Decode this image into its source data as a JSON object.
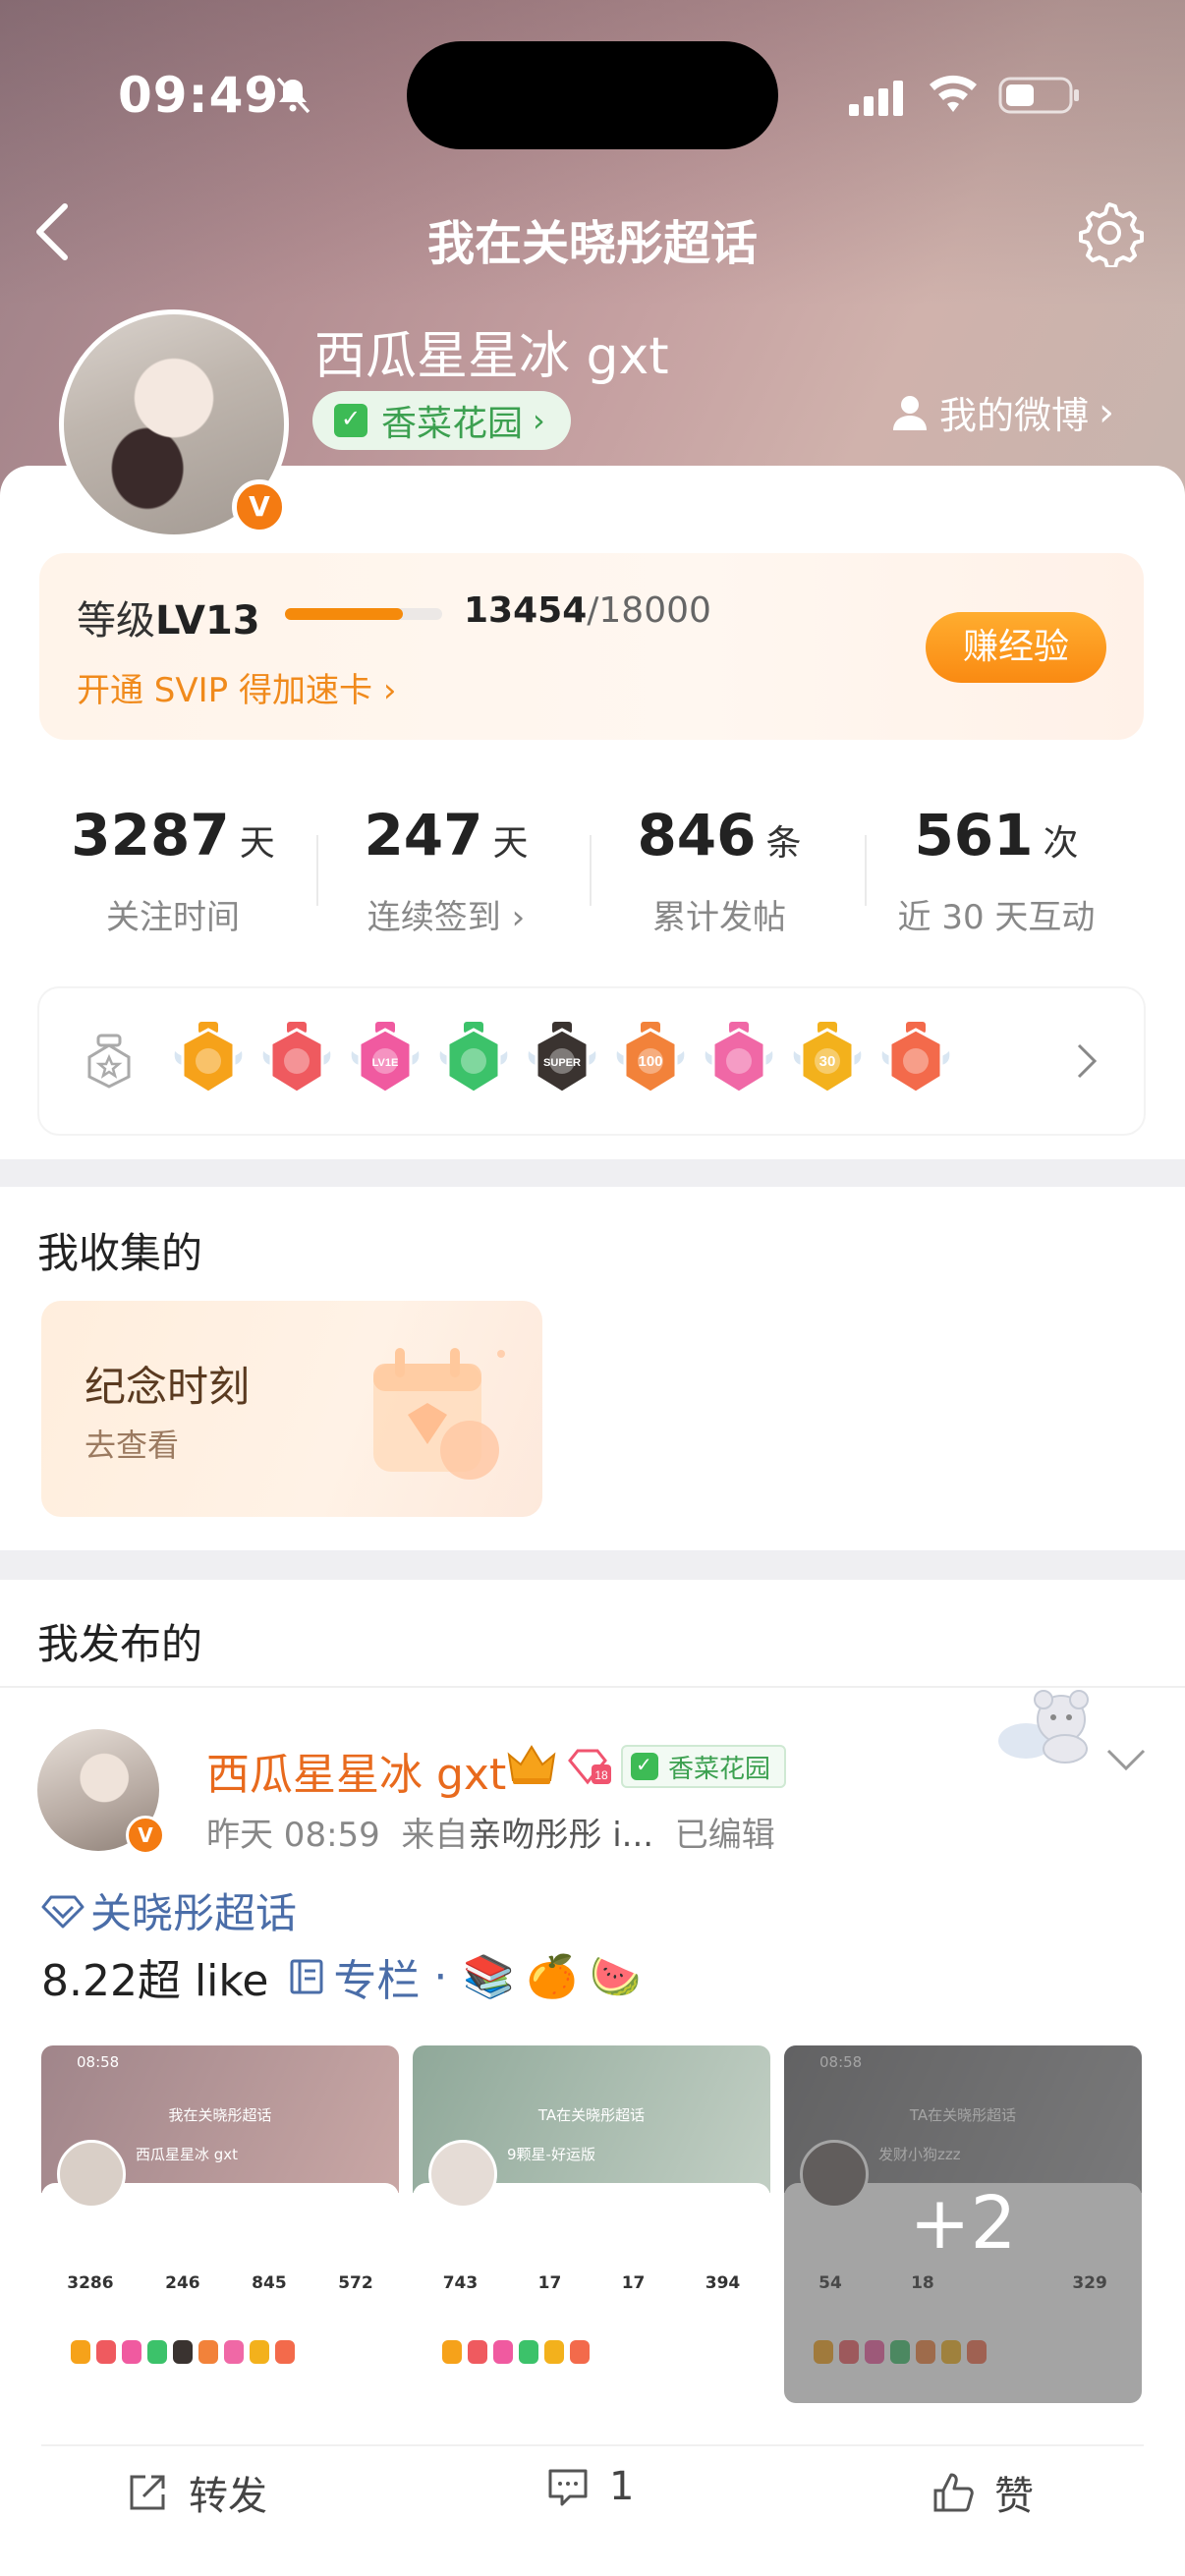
{
  "status_bar": {
    "time": "09:49"
  },
  "nav": {
    "title": "我在关晓彤超话"
  },
  "profile": {
    "username": "西瓜星星冰 gxt",
    "garden": "香菜花园",
    "my_weibo": "我的微博",
    "verified_mark": "V"
  },
  "level": {
    "label_prefix": "等级",
    "level": "LV13",
    "current": "13454",
    "max": "/18000",
    "progress_fraction": 0.7475,
    "svip_text": "开通 SVIP 得加速卡",
    "earn_button": "赚经验"
  },
  "stats": [
    {
      "value": "3287",
      "unit": "天",
      "label": "关注时间"
    },
    {
      "value": "247",
      "unit": "天",
      "label": "连续签到"
    },
    {
      "value": "846",
      "unit": "条",
      "label": "累计发帖"
    },
    {
      "value": "561",
      "unit": "次",
      "label": "近 30 天互动"
    }
  ],
  "medals": [
    {
      "icon": "crown-medal-icon",
      "color": "#f6a21a"
    },
    {
      "icon": "trophy-medal-icon",
      "color": "#ef5a5f"
    },
    {
      "icon": "lv-medal-icon",
      "color": "#f05aa0",
      "text": "LV1E"
    },
    {
      "icon": "hand-medal-icon",
      "color": "#3cc26a"
    },
    {
      "icon": "super-medal-icon",
      "color": "#3a3330",
      "text": "SUPER"
    },
    {
      "icon": "100-days-medal-icon",
      "color": "#f2823a",
      "text": "100"
    },
    {
      "icon": "cap-medal-icon",
      "color": "#f068a6"
    },
    {
      "icon": "30-days-medal-icon",
      "color": "#f3b11c",
      "text": "30"
    },
    {
      "icon": "rock-medal-icon",
      "color": "#f36a4b"
    }
  ],
  "collected": {
    "title": "我收集的",
    "card_title": "纪念时刻",
    "card_action": "去查看"
  },
  "published": {
    "title": "我发布的",
    "post": {
      "author": "西瓜星星冰 gxt",
      "garden": "香菜花园",
      "time": "昨天 08:59",
      "from_prefix": "来自",
      "source": "亲吻彤彤 i...",
      "edited": "已编辑",
      "topic": "关晓彤超话",
      "text": "8.22超 like",
      "column": "专栏",
      "dot": "·",
      "emojis": "📚🍊🍉",
      "more_images": "+2",
      "thumbs": [
        {
          "time": "08:58",
          "title": "我在关晓彤超话",
          "name": "西瓜星星冰 gxt",
          "stats": [
            "3286",
            "246",
            "845",
            "572"
          ]
        },
        {
          "time": "",
          "title": "TA在关晓彤超话",
          "name": "9颗星-好运版",
          "stats": [
            "743",
            "17",
            "17",
            "394"
          ]
        },
        {
          "time": "08:58",
          "title": "TA在关晓彤超话",
          "name": "发财小狗zzz",
          "stats": [
            "54",
            "18",
            "",
            "329"
          ]
        }
      ],
      "actions": {
        "repost": "转发",
        "comment": "1",
        "like": "赞"
      }
    }
  },
  "colors": {
    "accent_orange": "#f58a0b",
    "link_blue": "#4a6da8",
    "green": "#3ca050"
  }
}
